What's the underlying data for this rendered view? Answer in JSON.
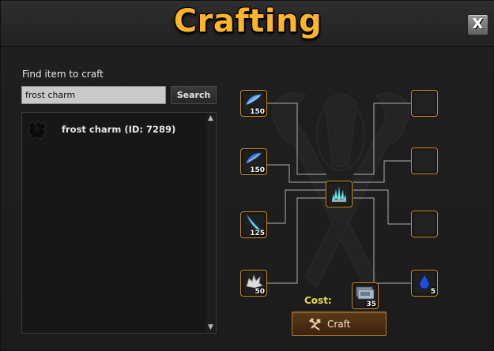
{
  "window": {
    "title": "Crafting",
    "close_label": "X"
  },
  "search": {
    "label": "Find item to craft",
    "value": "frost charm",
    "button_label": "Search"
  },
  "results": [
    {
      "label": "frost charm (ID: 7289)",
      "icon": "frost-charm-icon"
    }
  ],
  "recipe": {
    "result_icon": "ice-crystal-icon",
    "ingredients": [
      {
        "icon": "blue-feather-icon",
        "quantity": "150"
      },
      {
        "icon": "blue-feather-icon",
        "quantity": "150"
      },
      {
        "icon": "ice-shard-icon",
        "quantity": "125"
      },
      {
        "icon": "white-fur-icon",
        "quantity": "50"
      },
      {
        "icon": "empty-slot",
        "quantity": ""
      },
      {
        "icon": "empty-slot",
        "quantity": ""
      },
      {
        "icon": "empty-slot",
        "quantity": ""
      },
      {
        "icon": "blue-drop-icon",
        "quantity": "5"
      }
    ],
    "cost": {
      "label": "Cost:",
      "icon": "currency-notes-icon",
      "quantity": "35"
    },
    "craft_button_label": "Craft"
  },
  "colors": {
    "title": "#ffb52a",
    "slot_border": "#c98a1e",
    "cost_label": "#e8d84a"
  }
}
